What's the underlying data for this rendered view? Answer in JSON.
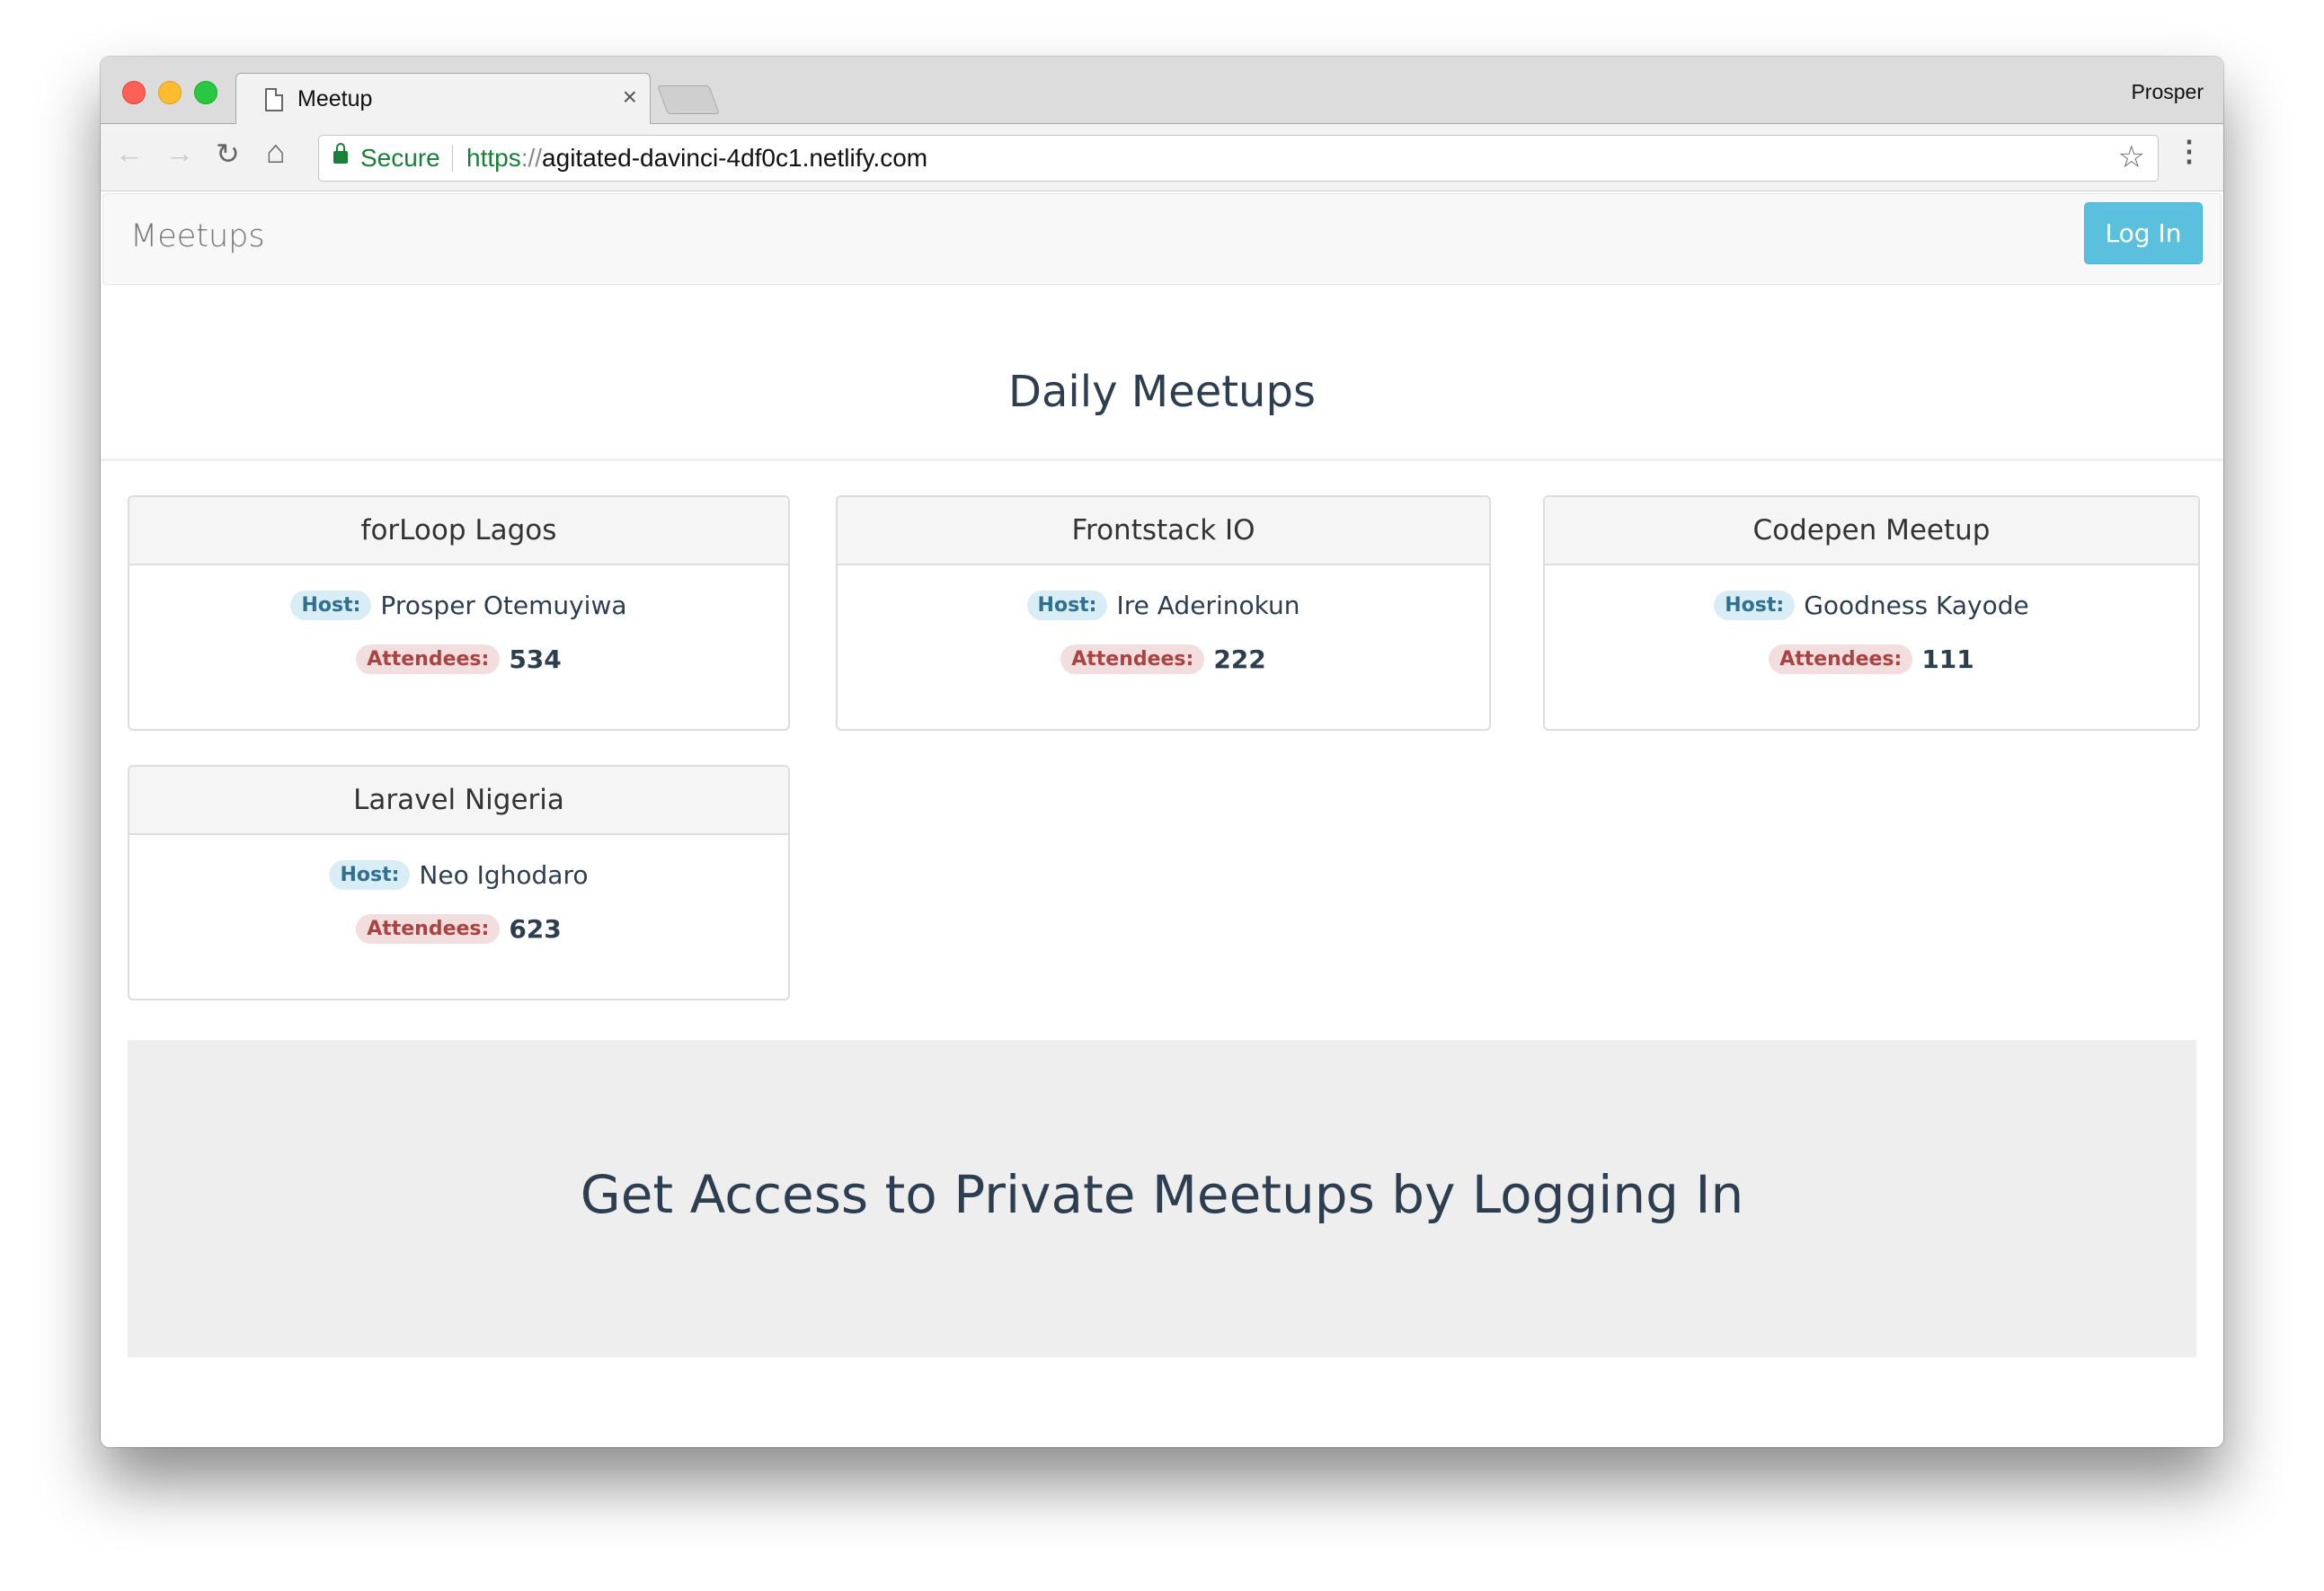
{
  "browser": {
    "tab_title": "Meetup",
    "tab_close_icon": "close-icon",
    "profile_name": "Prosper",
    "secure_label": "Secure",
    "url_scheme": "https",
    "url_slashes": "://",
    "url_host": "agitated-davinci-4df0c1.netlify.com",
    "icons": {
      "back": "←",
      "forward": "→",
      "reload": "↻",
      "home": "⌂",
      "star": "☆",
      "menu": "⋮",
      "close": "×"
    }
  },
  "navbar": {
    "brand": "Meetups",
    "login_label": "Log In",
    "login_color": "#5bc0de"
  },
  "main": {
    "title": "Daily Meetups",
    "host_label": "Host:",
    "attendees_label": "Attendees:",
    "meetups": [
      {
        "name": "forLoop Lagos",
        "host": "Prosper Otemuyiwa",
        "attendees": "534"
      },
      {
        "name": "Frontstack IO",
        "host": "Ire Aderinokun",
        "attendees": "222"
      },
      {
        "name": "Codepen Meetup",
        "host": "Goodness Kayode",
        "attendees": "111"
      },
      {
        "name": "Laravel Nigeria",
        "host": "Neo Ighodaro",
        "attendees": "623"
      }
    ]
  },
  "jumbotron": {
    "text": "Get Access to Private Meetups by Logging In"
  }
}
